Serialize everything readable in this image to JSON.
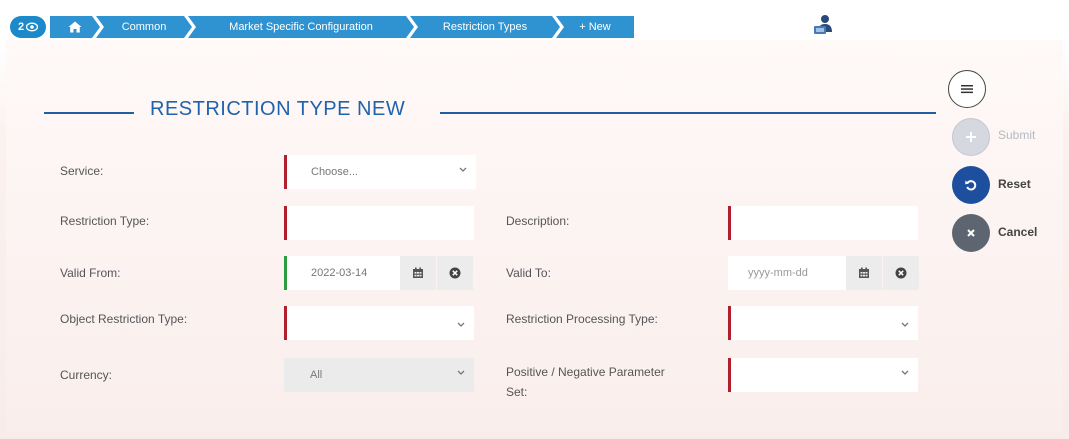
{
  "breadcrumb": {
    "count": "2",
    "items": [
      "Common",
      "Market Specific Configuration",
      "Restriction Types",
      "+ New"
    ]
  },
  "page": {
    "title": "RESTRICTION TYPE NEW"
  },
  "form": {
    "service": {
      "label": "Service:",
      "value": "Choose..."
    },
    "restriction_type": {
      "label": "Restriction Type:",
      "value": ""
    },
    "description": {
      "label": "Description:",
      "value": ""
    },
    "valid_from": {
      "label": "Valid From:",
      "value": "2022-03-14"
    },
    "valid_to": {
      "label": "Valid To:",
      "placeholder": "yyyy-mm-dd"
    },
    "object_restriction_type": {
      "label": "Object Restriction Type:",
      "value": ""
    },
    "restriction_processing_type": {
      "label": "Restriction Processing Type:",
      "value": ""
    },
    "currency": {
      "label": "Currency:",
      "value": "All"
    },
    "pos_neg_param_set": {
      "label_line1": "Positive / Negative Parameter",
      "label_line2": "Set:",
      "value": ""
    }
  },
  "actions": {
    "submit": "Submit",
    "reset": "Reset",
    "cancel": "Cancel"
  },
  "colors": {
    "breadcrumb": "#2e93d0",
    "title": "#2063ad",
    "mandatory": "#b01f2b",
    "valid": "#2e9c3e",
    "reset": "#1e4f9e",
    "cancel": "#5d6670"
  }
}
